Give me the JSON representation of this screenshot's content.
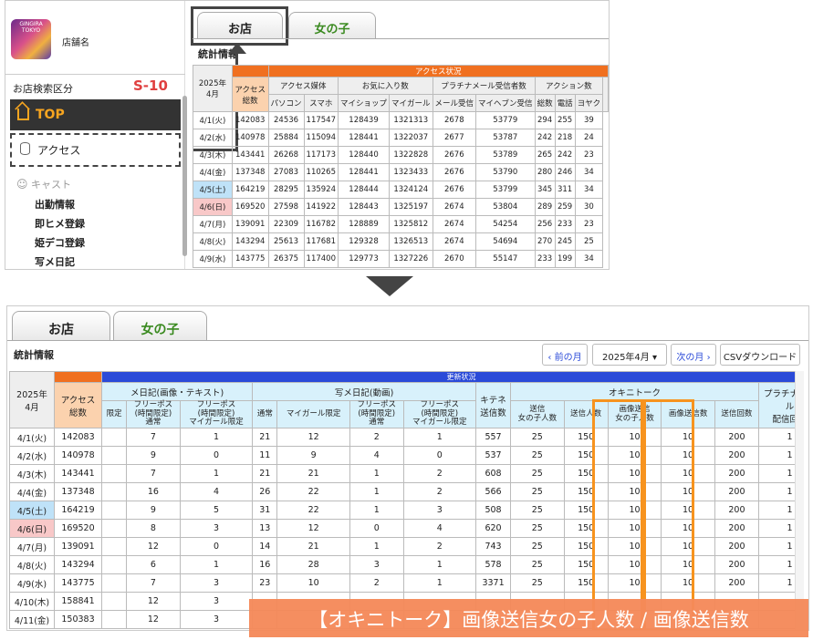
{
  "top": {
    "logo_text": "GINGIRA TOKYO",
    "shop_label": "店舗名",
    "search_label": "お店検索区分",
    "search_code": "S-10",
    "nav_top": "TOP",
    "nav_access": "アクセス",
    "nav_cast": "キャスト",
    "cast_items": [
      "出勤情報",
      "即ヒメ登録",
      "姫デコ登録",
      "写メ日記"
    ],
    "tabs": [
      "お店",
      "女の子"
    ],
    "stats_title": "統計情報",
    "table": {
      "corner": "2025年\n4月",
      "group_header": "アクセス状況",
      "access_total": "アクセス\n総数",
      "groups": [
        "アクセス媒体",
        "お気に入り数",
        "プラチナメール受信者数",
        "アクション数"
      ],
      "subheaders": [
        "パソコン",
        "スマホ",
        "マイショップ",
        "マイガール",
        "メール受信",
        "マイヘブン受信",
        "総数",
        "電話",
        "ヨヤク"
      ],
      "rows": [
        [
          "4/1(火)",
          "142083",
          "24536",
          "117547",
          "128439",
          "1321313",
          "2678",
          "53779",
          "294",
          "255",
          "39"
        ],
        [
          "4/2(水)",
          "140978",
          "25884",
          "115094",
          "128441",
          "1322037",
          "2677",
          "53787",
          "242",
          "218",
          "24"
        ],
        [
          "4/3(木)",
          "143441",
          "26268",
          "117173",
          "128440",
          "1322828",
          "2676",
          "53789",
          "265",
          "242",
          "23"
        ],
        [
          "4/4(金)",
          "137348",
          "27083",
          "110265",
          "128441",
          "1323433",
          "2676",
          "53790",
          "280",
          "246",
          "34"
        ],
        [
          "4/5(土)",
          "164219",
          "28295",
          "135924",
          "128444",
          "1324124",
          "2676",
          "53799",
          "345",
          "311",
          "34"
        ],
        [
          "4/6(日)",
          "169520",
          "27598",
          "141922",
          "128443",
          "1325197",
          "2674",
          "53804",
          "289",
          "259",
          "30"
        ],
        [
          "4/7(月)",
          "139091",
          "22309",
          "116782",
          "128889",
          "1325812",
          "2674",
          "54254",
          "256",
          "233",
          "23"
        ],
        [
          "4/8(火)",
          "143294",
          "25613",
          "117681",
          "129328",
          "1326513",
          "2674",
          "54694",
          "270",
          "245",
          "25"
        ],
        [
          "4/9(水)",
          "143775",
          "26375",
          "117400",
          "129773",
          "1327226",
          "2670",
          "55147",
          "233",
          "199",
          "34"
        ]
      ]
    }
  },
  "bottom": {
    "tabs": [
      "お店",
      "女の子"
    ],
    "stats_title": "統計情報",
    "prev_month": "前の月",
    "month_value": "2025年4月",
    "next_month": "次の月",
    "csv_download": "CSVダウンロード",
    "table": {
      "corner": "2025年\n4月",
      "group_header": "更新状況",
      "access_total": "アクセス\n総数",
      "groups": [
        "メ日記(画像・テキスト)",
        "写メ日記(動画)",
        "キテネ\n送信数",
        "オキニトーク",
        "プラチナメール\n配信回数"
      ],
      "subheaders": [
        "限定",
        "フリーポス\n(時間限定)\n通常",
        "フリーポス\n(時間限定)\nマイガール限定",
        "通常",
        "マイガール限定",
        "フリーポス\n(時間限定)\n通常",
        "フリーポス\n(時間限定)\nマイガール限定",
        "送信\n女の子人数",
        "送信人数",
        "画像送信\n女の子人数",
        "画像送信数",
        "送信回数"
      ],
      "rows": [
        [
          "4/1(火)",
          "142083",
          "",
          "7",
          "1",
          "21",
          "12",
          "2",
          "1",
          "557",
          "25",
          "150",
          "10",
          "10",
          "200",
          "1"
        ],
        [
          "4/2(水)",
          "140978",
          "",
          "9",
          "0",
          "11",
          "9",
          "4",
          "0",
          "537",
          "25",
          "150",
          "10",
          "10",
          "200",
          "1"
        ],
        [
          "4/3(木)",
          "143441",
          "",
          "7",
          "1",
          "21",
          "21",
          "1",
          "2",
          "608",
          "25",
          "150",
          "10",
          "10",
          "200",
          "1"
        ],
        [
          "4/4(金)",
          "137348",
          "",
          "16",
          "4",
          "26",
          "22",
          "1",
          "2",
          "566",
          "25",
          "150",
          "10",
          "10",
          "200",
          "1"
        ],
        [
          "4/5(土)",
          "164219",
          "",
          "9",
          "5",
          "31",
          "22",
          "1",
          "3",
          "508",
          "25",
          "150",
          "10",
          "10",
          "200",
          "1"
        ],
        [
          "4/6(日)",
          "169520",
          "",
          "8",
          "3",
          "13",
          "12",
          "0",
          "4",
          "620",
          "25",
          "150",
          "10",
          "10",
          "200",
          "1"
        ],
        [
          "4/7(月)",
          "139091",
          "",
          "12",
          "0",
          "14",
          "21",
          "1",
          "2",
          "743",
          "25",
          "150",
          "10",
          "10",
          "200",
          "1"
        ],
        [
          "4/8(火)",
          "143294",
          "",
          "6",
          "1",
          "16",
          "28",
          "3",
          "1",
          "578",
          "25",
          "150",
          "10",
          "10",
          "200",
          "1"
        ],
        [
          "4/9(水)",
          "143775",
          "",
          "7",
          "3",
          "23",
          "10",
          "2",
          "1",
          "3371",
          "25",
          "150",
          "10",
          "10",
          "200",
          "1"
        ],
        [
          "4/10(木)",
          "158841",
          "",
          "12",
          "3",
          "",
          "",
          "",
          "",
          "",
          "",
          "",
          "",
          "",
          "",
          ""
        ],
        [
          "4/11(金)",
          "150383",
          "",
          "12",
          "3",
          "",
          "",
          "",
          "",
          "",
          "",
          "",
          "",
          "",
          "",
          ""
        ]
      ]
    }
  },
  "banner": "【オキニトーク】画像送信女の子人数 / 画像送信数",
  "colors": {
    "orange": "#f07020",
    "blue": "#2a4ad8",
    "highlight": "#f7931e",
    "banner": "#f58a5a"
  }
}
